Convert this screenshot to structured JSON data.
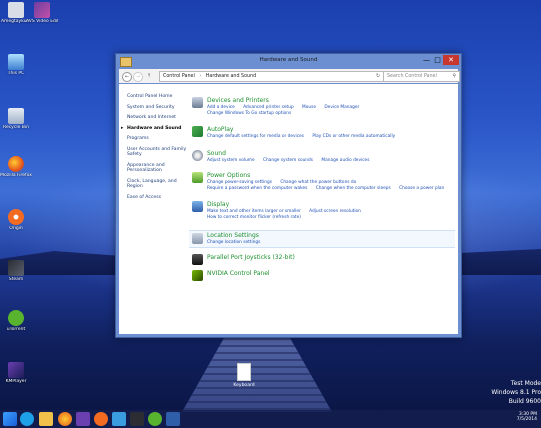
{
  "desktop": {
    "icons": [
      {
        "label": "Amegtayku…"
      },
      {
        "label": "AVS Video Editor"
      },
      {
        "label": "This PC"
      },
      {
        "label": "Recycle Bin"
      },
      {
        "label": "Mozilla Firefox"
      },
      {
        "label": "Origin"
      },
      {
        "label": "Steam"
      },
      {
        "label": "uTorrent"
      },
      {
        "label": "KMPlayer"
      }
    ],
    "file_label": "Keyboard",
    "watermark": [
      "Test Mode",
      "Windows 8.1 Pro",
      "Build 9600"
    ]
  },
  "window": {
    "title": "Hardware and Sound",
    "controls": {
      "minimize": "—",
      "maximize": "□",
      "close": "✕"
    },
    "address": {
      "back": "←",
      "forward": "→",
      "up": "↑",
      "crumbs": [
        "Control Panel",
        "Hardware and Sound"
      ],
      "separator": "›",
      "refresh": "↻",
      "search_placeholder": "Search Control Panel",
      "search_icon": "search-icon"
    },
    "nav": [
      {
        "label": "Control Panel Home"
      },
      {
        "label": "System and Security"
      },
      {
        "label": "Network and Internet"
      },
      {
        "label": "Hardware and Sound",
        "active": true
      },
      {
        "label": "Programs"
      },
      {
        "label": "User Accounts and Family Safety"
      },
      {
        "label": "Appearance and Personalization"
      },
      {
        "label": "Clock, Language, and Region"
      },
      {
        "label": "Ease of Access"
      }
    ],
    "categories": [
      {
        "head": "Devices and Printers",
        "links": [
          "Add a device",
          "Advanced printer setup",
          "Mouse",
          "Device Manager",
          "Change Windows To Go startup options"
        ]
      },
      {
        "head": "AutoPlay",
        "links": [
          "Change default settings for media or devices",
          "Play CDs or other media automatically"
        ]
      },
      {
        "head": "Sound",
        "links": [
          "Adjust system volume",
          "Change system sounds",
          "Manage audio devices"
        ]
      },
      {
        "head": "Power Options",
        "links": [
          "Change power-saving settings",
          "Change what the power buttons do",
          "Require a password when the computer wakes",
          "Change when the computer sleeps",
          "Choose a power plan"
        ]
      },
      {
        "head": "Display",
        "links": [
          "Make text and other items larger or smaller",
          "Adjust screen resolution",
          "How to correct monitor flicker (refresh rate)"
        ]
      },
      {
        "head": "Location Settings",
        "links": [
          "Change location settings"
        ]
      },
      {
        "head": "Parallel Port Joysticks (32-bit)",
        "links": []
      },
      {
        "head": "NVIDIA Control Panel",
        "links": []
      }
    ]
  },
  "taskbar": {
    "time": "3:30 PM",
    "date": "7/5/2014"
  }
}
